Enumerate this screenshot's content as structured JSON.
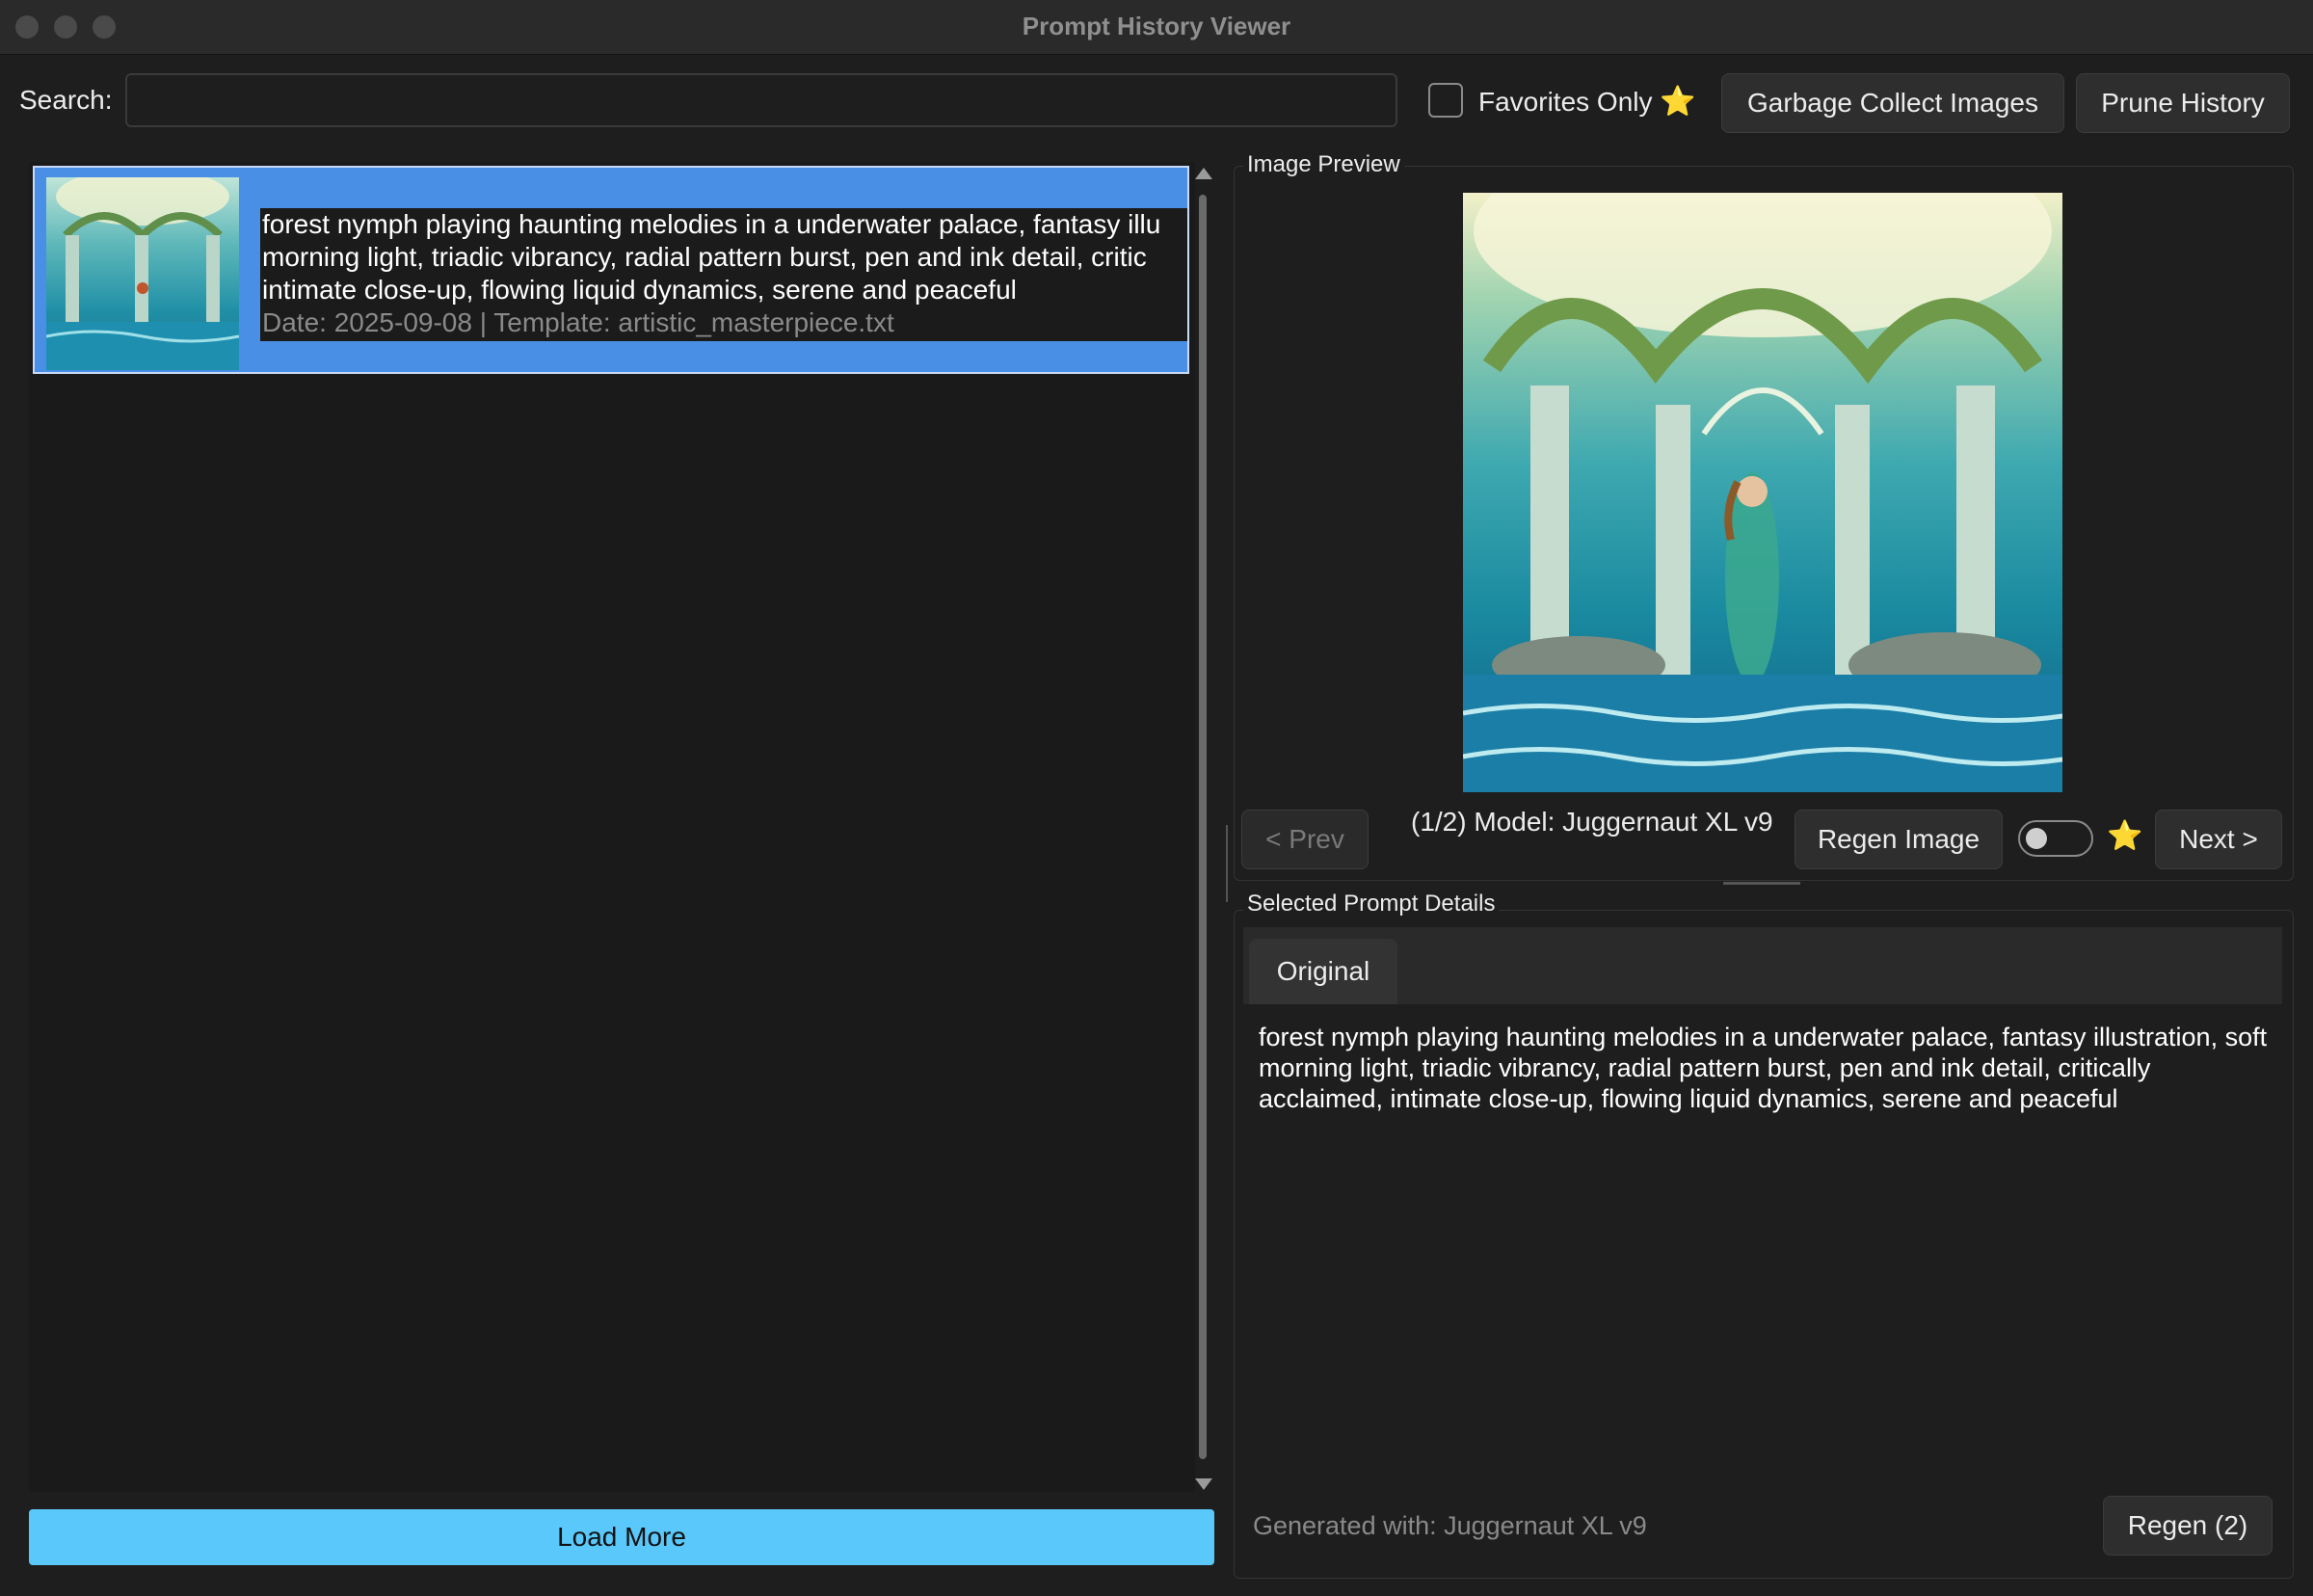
{
  "window": {
    "title": "Prompt History Viewer"
  },
  "toolbar": {
    "search_label": "Search:",
    "search_value": "",
    "favorites_label": "Favorites Only",
    "favorites_star": "⭐",
    "garbage_collect_label": "Garbage Collect Images",
    "prune_history_label": "Prune History"
  },
  "history_list": {
    "items": [
      {
        "prompt_lines": [
          "forest nymph playing haunting melodies in a underwater palace, fantasy illu",
          "morning light, triadic vibrancy, radial pattern burst, pen and ink detail, critic",
          "intimate close-up, flowing liquid dynamics, serene and peaceful"
        ],
        "meta": "Date: 2025-09-08 | Template: artistic_masterpiece.txt",
        "selected": true
      }
    ],
    "load_more_label": "Load More"
  },
  "image_preview": {
    "group_title": "Image Preview",
    "prev_label": "< Prev",
    "model_info": "(1/2) Model: Juggernaut XL v9",
    "regen_image_label": "Regen Image",
    "favorite_toggle_on": false,
    "star": "⭐",
    "next_label": "Next >"
  },
  "details": {
    "group_title": "Selected Prompt Details",
    "tabs": [
      {
        "label": "Original"
      }
    ],
    "text": "forest nymph playing haunting melodies in a underwater palace, fantasy illustration, soft morning light, triadic vibrancy, radial pattern burst, pen and ink detail, critically acclaimed, intimate close-up, flowing liquid dynamics, serene and peaceful",
    "generated_with": "Generated with: Juggernaut XL v9",
    "regen_label": "Regen (2)"
  },
  "colors": {
    "accent_selection": "#4a8fe6",
    "load_more_bg": "#5ac8fa",
    "star": "#f5c518"
  }
}
